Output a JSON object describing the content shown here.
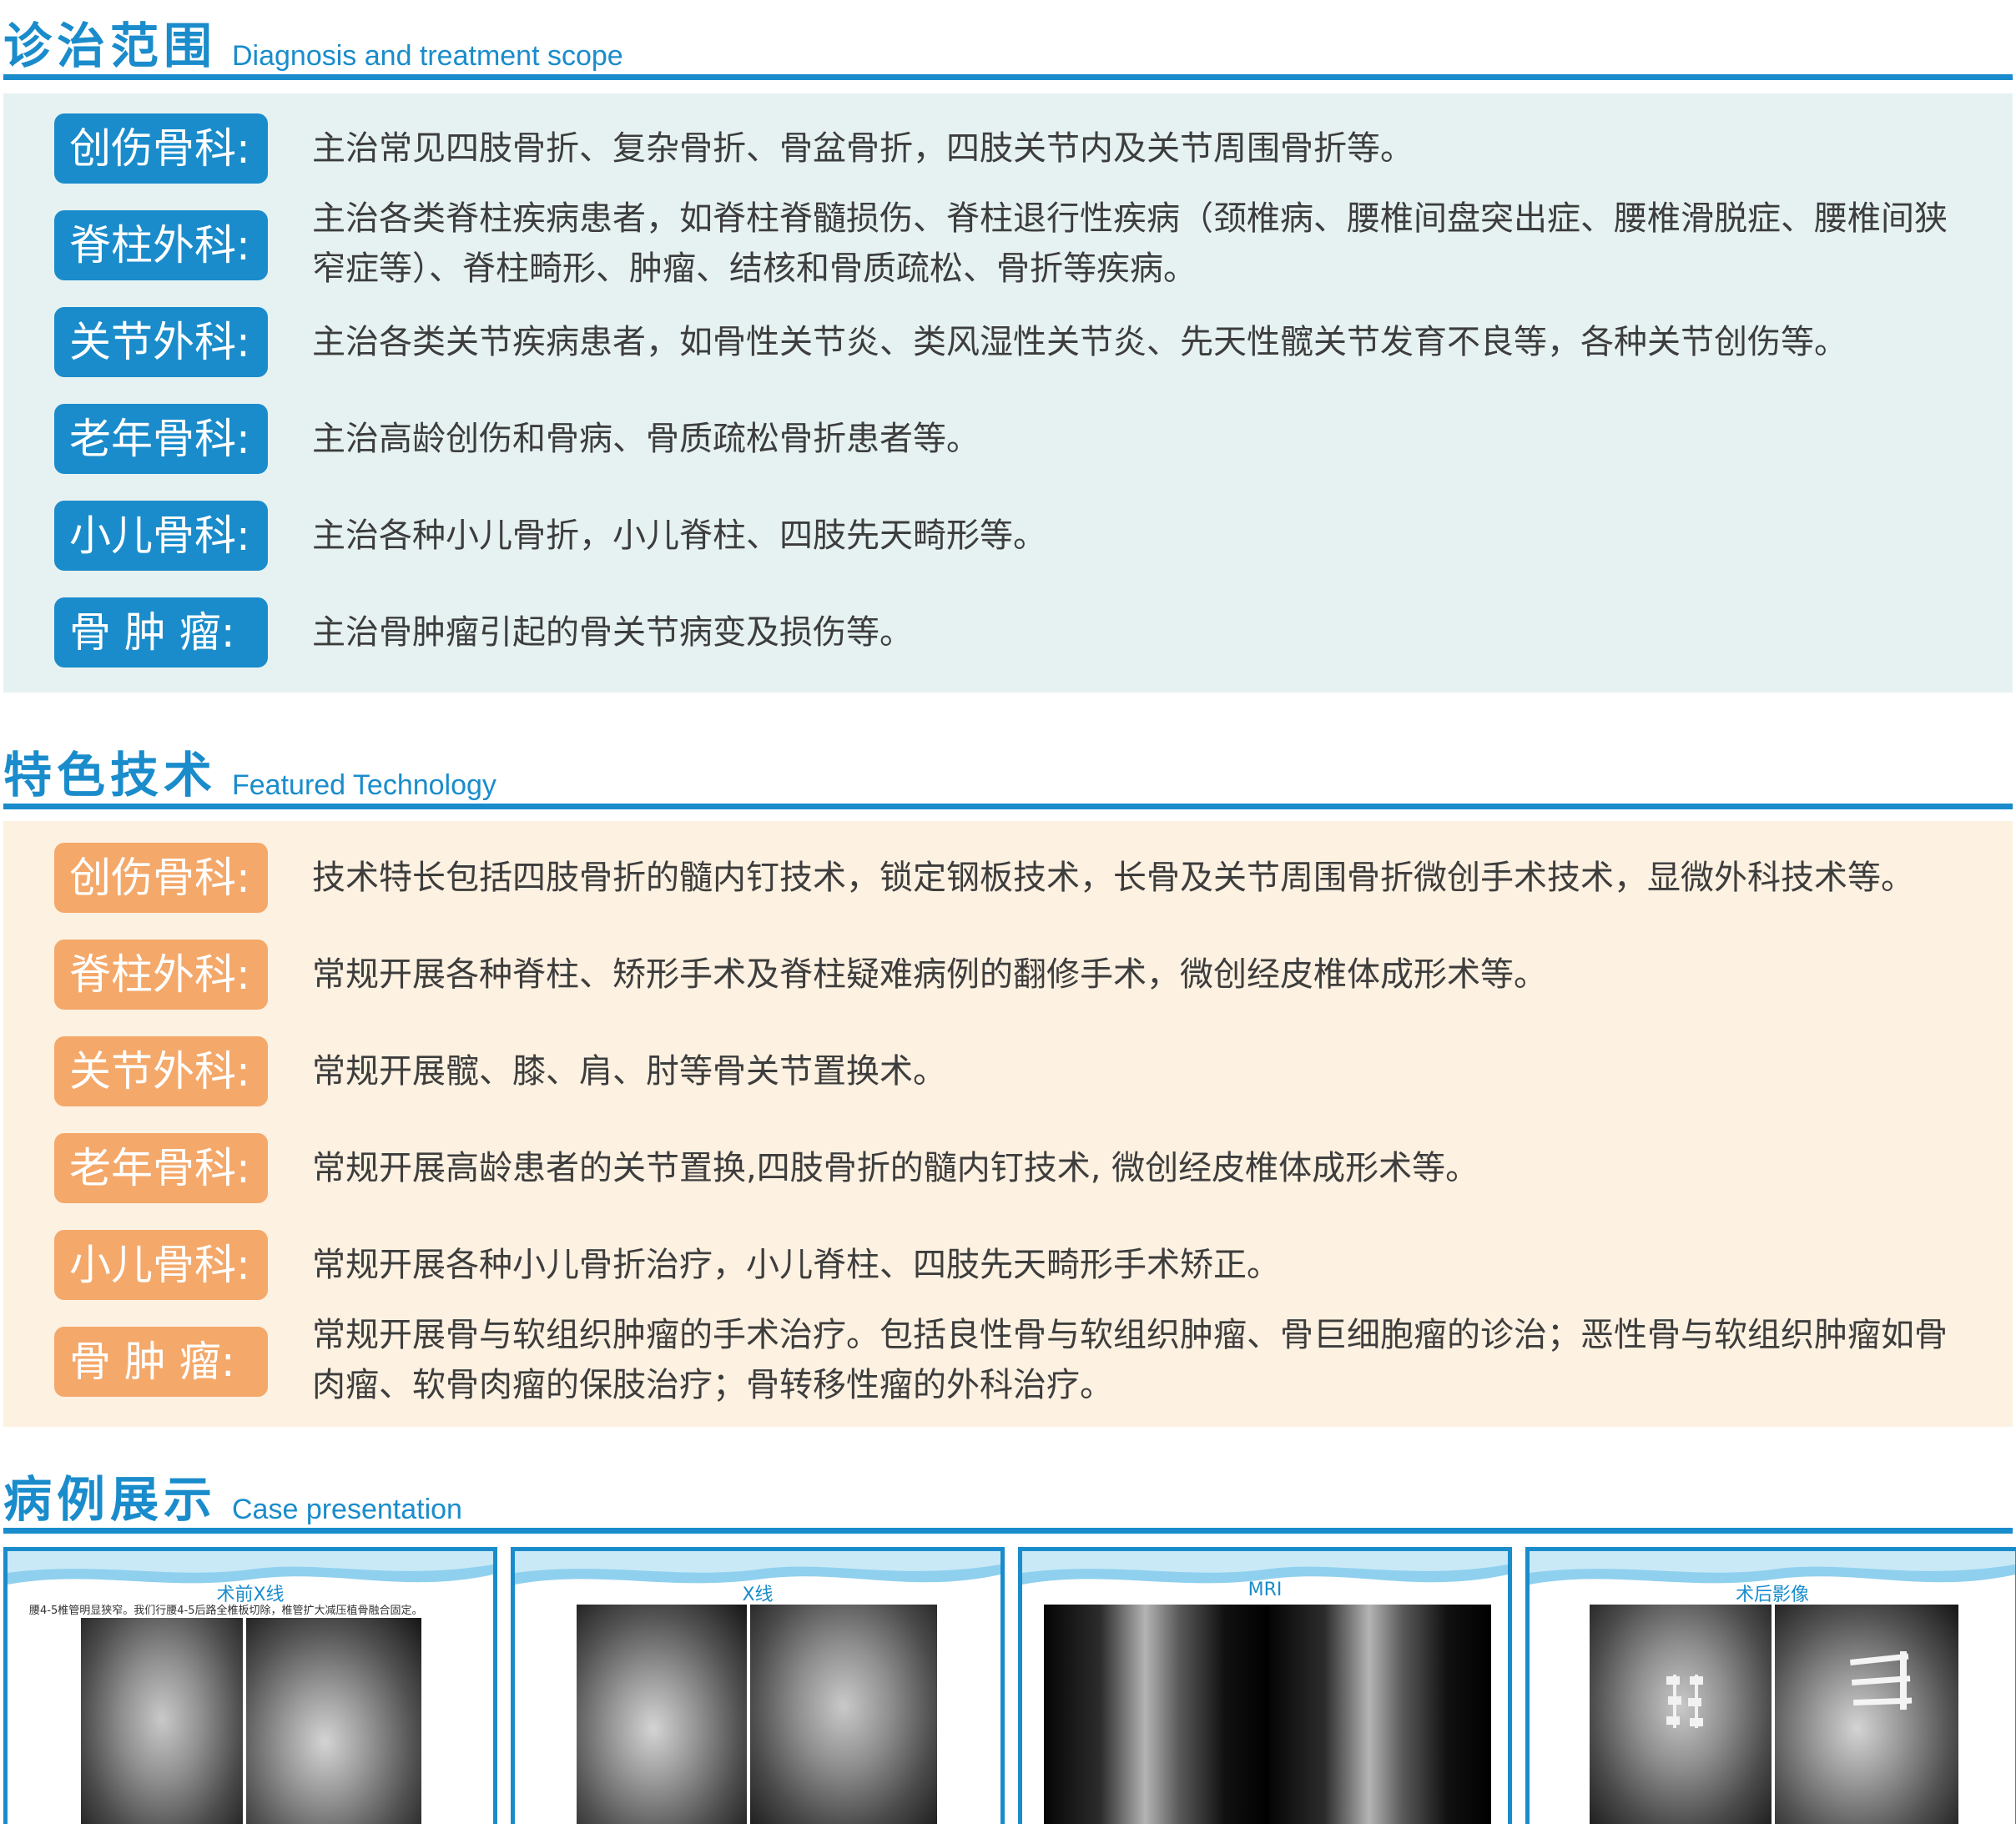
{
  "sections": {
    "scope": {
      "title_zh": "诊治范围",
      "title_en": "Diagnosis and treatment scope",
      "rows": [
        {
          "label": "创伤骨科:",
          "text": "主治常见四肢骨折、复杂骨折、骨盆骨折，四肢关节内及关节周围骨折等。"
        },
        {
          "label": "脊柱外科:",
          "text": "主治各类脊柱疾病患者，如脊柱脊髓损伤、脊柱退行性疾病（颈椎病、腰椎间盘突出症、腰椎滑脱症、腰椎间狭窄症等）、脊柱畸形、肿瘤、结核和骨质疏松、骨折等疾病。"
        },
        {
          "label": "关节外科:",
          "text": "主治各类关节疾病患者，如骨性关节炎、类风湿性关节炎、先天性髋关节发育不良等，各种关节创伤等。"
        },
        {
          "label": "老年骨科:",
          "text": "主治高龄创伤和骨病、骨质疏松骨折患者等。"
        },
        {
          "label": "小儿骨科:",
          "text": "主治各种小儿骨折，小儿脊柱、四肢先天畸形等。"
        },
        {
          "label": "骨 肿 瘤:",
          "text": "主治骨肿瘤引起的骨关节病变及损伤等。"
        }
      ]
    },
    "tech": {
      "title_zh": "特色技术",
      "title_en": "Featured Technology",
      "rows": [
        {
          "label": "创伤骨科:",
          "text": "技术特长包括四肢骨折的髓内钉技术，锁定钢板技术，长骨及关节周围骨折微创手术技术，显微外科技术等。"
        },
        {
          "label": "脊柱外科:",
          "text": "常规开展各种脊柱、矫形手术及脊柱疑难病例的翻修手术，微创经皮椎体成形术等。"
        },
        {
          "label": "关节外科:",
          "text": "常规开展髋、膝、肩、肘等骨关节置换术。"
        },
        {
          "label": "老年骨科:",
          "text": "常规开展高龄患者的关节置换,四肢骨折的髓内钉技术, 微创经皮椎体成形术等。"
        },
        {
          "label": "小儿骨科:",
          "text": "常规开展各种小儿骨折治疗，小儿脊柱、四肢先天畸形手术矫正。"
        },
        {
          "label": "骨 肿 瘤:",
          "text": "常规开展骨与软组织肿瘤的手术治疗。包括良性骨与软组织肿瘤、骨巨细胞瘤的诊治；恶性骨与软组织肿瘤如骨肉瘤、软骨肉瘤的保肢治疗；骨转移性瘤的外科治疗。"
        }
      ]
    },
    "cases": {
      "title_zh": "病例展示",
      "title_en": "Case presentation",
      "panels": [
        {
          "title": "术前X线",
          "note": "腰4-5椎管明显狭窄。我们行腰4-5后路全椎板切除，椎管扩大减压植骨融合固定。"
        },
        {
          "title": "X线",
          "note": ""
        },
        {
          "title": "MRI",
          "note": ""
        },
        {
          "title": "术后影像",
          "note": ""
        }
      ]
    }
  },
  "colors": {
    "primary_blue": "#1a8ccb",
    "badge_orange": "#f4a86a",
    "panel_blue_bg": "#e6f2f1",
    "panel_orange_bg": "#fdf1e1"
  }
}
